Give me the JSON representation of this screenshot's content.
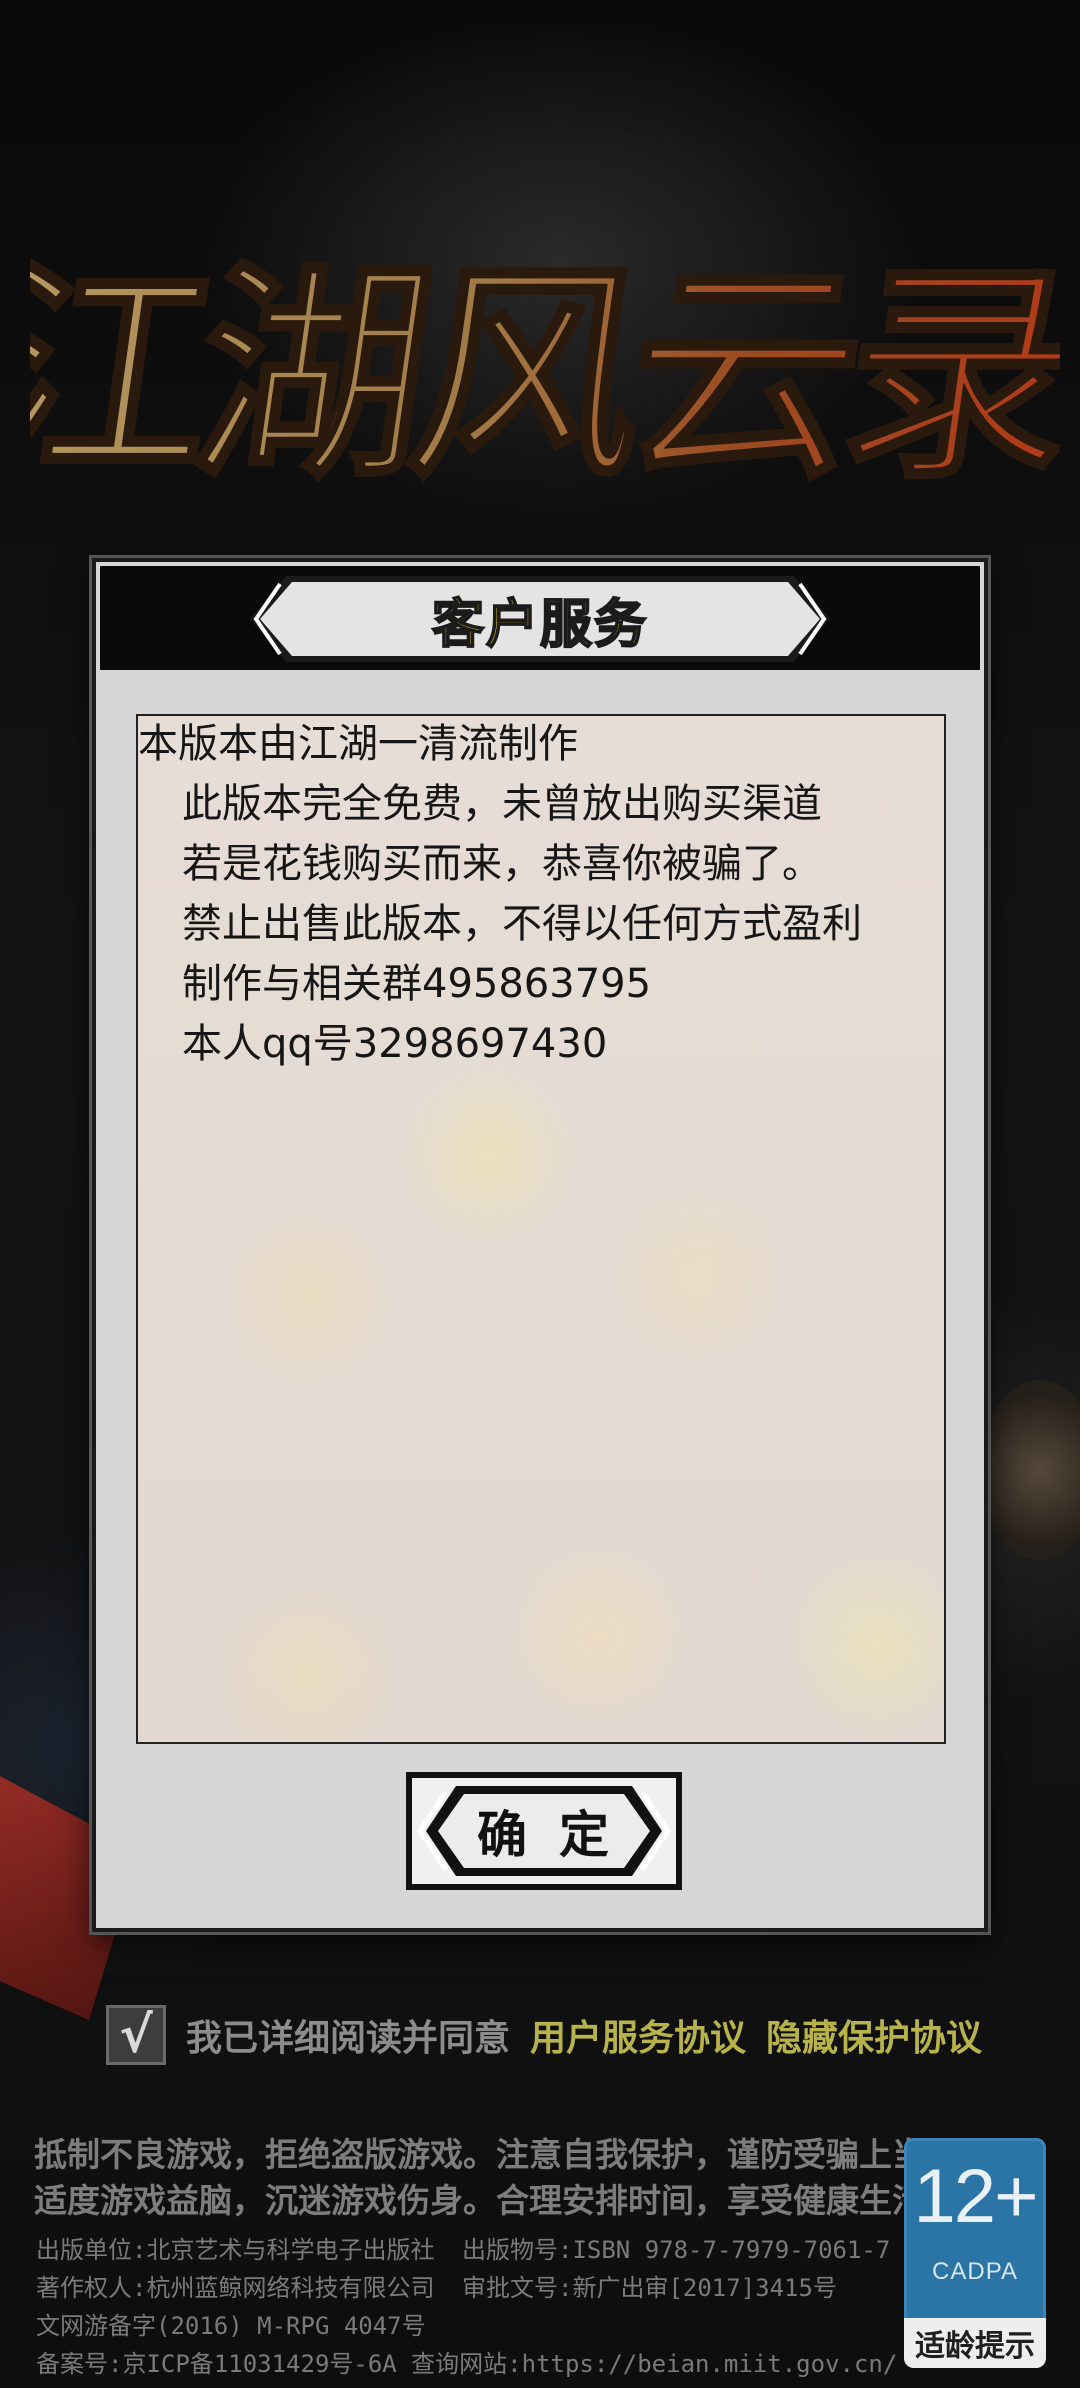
{
  "game": {
    "logo_text": "江湖风云录"
  },
  "dialog": {
    "title": "客户服务",
    "lines": [
      "本版本由江湖一清流制作",
      "此版本完全免费，未曾放出购买渠道",
      "若是花钱购买而来，恭喜你被骗了。",
      "禁止出售此版本，不得以任何方式盈利",
      "制作与相关群495863795",
      "本人qq号3298697430"
    ],
    "confirm_label": "确定"
  },
  "agreement": {
    "checked": true,
    "check_mark": "√",
    "text": "我已详细阅读并同意",
    "link_service": "用户服务协议",
    "link_privacy": "隐藏保护协议"
  },
  "notice": {
    "line1": "抵制不良游戏，拒绝盗版游戏。注意自我保护，谨防受骗上当。",
    "line2": "适度游戏益脑，沉迷游戏伤身。合理安排时间，享受健康生活。"
  },
  "publishing": {
    "publisher": "出版单位:北京艺术与科学电子出版社",
    "isbn": "出版物号:ISBN  978-7-7979-7061-7",
    "copyright": "著作权人:杭州蓝鲸网络科技有限公司",
    "approval": "审批文号:新广出审[2017]3415号",
    "culture": "文网游备字(2016)  M-RPG  4047号",
    "icp": "备案号:京ICP备11031429号-6A  查询网站:https://beian.miit.gov.cn/"
  },
  "age_rating": {
    "number": "12+",
    "org": "CADPA",
    "tip": "适龄提示"
  },
  "colors": {
    "title_yellow": "#f1d21f",
    "link_yellow": "#b7b34a",
    "badge_blue": "#2b74a6"
  }
}
